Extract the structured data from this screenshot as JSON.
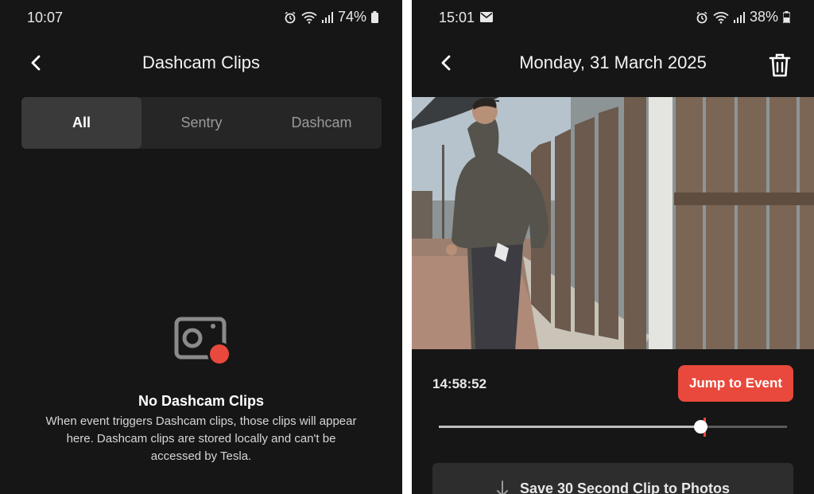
{
  "left": {
    "status": {
      "time": "10:07",
      "battery": "74%"
    },
    "title": "Dashcam Clips",
    "tabs": [
      {
        "label": "All",
        "active": true
      },
      {
        "label": "Sentry",
        "active": false
      },
      {
        "label": "Dashcam",
        "active": false
      }
    ],
    "empty": {
      "title": "No Dashcam Clips",
      "description": "When event triggers Dashcam clips, those clips will appear here. Dashcam clips are stored locally and can't be accessed by Tesla."
    }
  },
  "right": {
    "status": {
      "time": "15:01",
      "battery": "38%"
    },
    "title": "Monday, 31 March 2025",
    "timestamp": "14:58:52",
    "jump_label": "Jump to Event",
    "save_label": "Save 30 Second Clip to Photos",
    "playback_position": 0.75,
    "event_position": 0.76
  },
  "colors": {
    "background": "#161616",
    "accent": "#e8493c",
    "tab_bar": "#262626",
    "tab_active": "#3a3a3a"
  },
  "icons": {
    "back": "chevron-left-icon",
    "trash": "trash-icon",
    "empty_state": "camera-record-icon",
    "download": "arrow-down-icon",
    "alarm": "alarm-icon",
    "wifi": "wifi-icon",
    "signal": "signal-icon",
    "battery": "battery-icon",
    "mail": "mail-icon"
  }
}
